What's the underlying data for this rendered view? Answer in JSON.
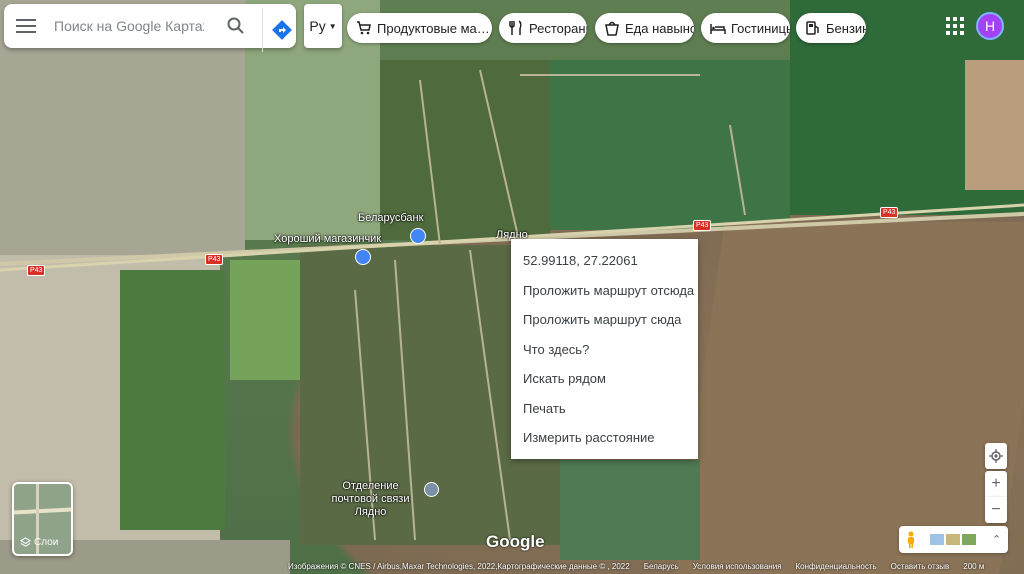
{
  "search": {
    "placeholder": "Поиск на Google Картах"
  },
  "lang": {
    "label": "Ру"
  },
  "chips": [
    {
      "label": "Продуктовые магазины",
      "icon": "cart-icon"
    },
    {
      "label": "Рестораны",
      "icon": "fork-knife-icon"
    },
    {
      "label": "Еда навынос",
      "icon": "takeout-bag-icon"
    },
    {
      "label": "Гостиницы",
      "icon": "bed-icon"
    },
    {
      "label": "Бензин",
      "icon": "gas-pump-icon"
    }
  ],
  "user": {
    "avatar_letter": "Н"
  },
  "map_labels": {
    "bank": "Беларусбанк",
    "shop": "Хороший магазинчик",
    "village": "Лядно",
    "post_office": "Отделение почтовой связи Лядно",
    "road_1": "P43",
    "road_2": "P43",
    "road_3": "P43",
    "road_4": "P43",
    "watermark": "Google"
  },
  "context_menu": {
    "coords": "52.99118, 27.22061",
    "items": [
      "Проложить маршрут отсюда",
      "Проложить маршрут сюда",
      "Что здесь?",
      "Искать рядом",
      "Печать",
      "Измерить расстояние"
    ]
  },
  "layers": {
    "label": "Слои"
  },
  "bottom_bar": {
    "attribution": "Изображения © CNES / Airbus,Maxar Technologies, 2022,Картографические данные © , 2022",
    "country": "Беларусь",
    "terms": "Условия использования",
    "privacy": "Конфиденциальность",
    "feedback": "Оставить отзыв",
    "scale": "200 м"
  },
  "colors": {
    "avatar": "#a142f4",
    "road_label": "#d93025",
    "directions": "#1a73e8"
  }
}
